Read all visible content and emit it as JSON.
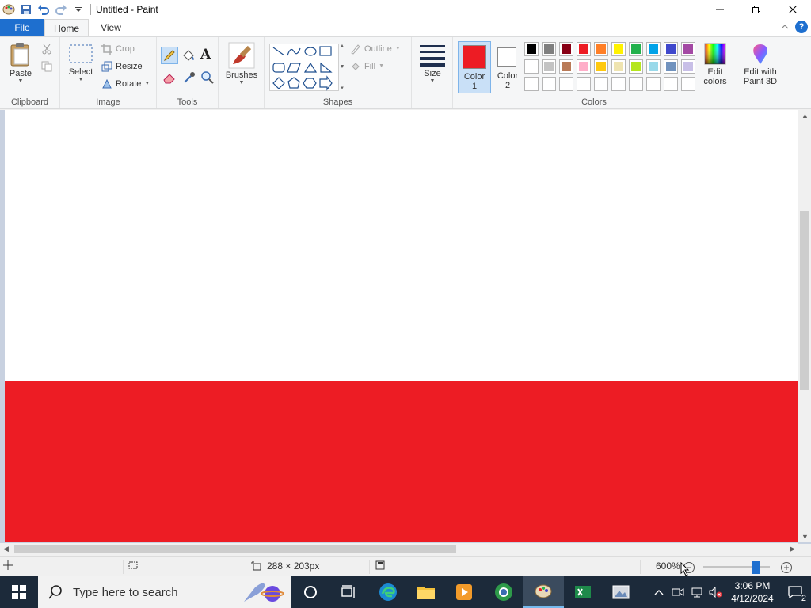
{
  "window": {
    "title": "Untitled - Paint"
  },
  "tabs": [
    {
      "label": "File"
    },
    {
      "label": "Home"
    },
    {
      "label": "View"
    }
  ],
  "ribbon": {
    "clipboard": {
      "group_label": "Clipboard",
      "paste": "Paste"
    },
    "image": {
      "group_label": "Image",
      "select": "Select",
      "crop": "Crop",
      "resize": "Resize",
      "rotate": "Rotate"
    },
    "tools": {
      "group_label": "Tools"
    },
    "brushes": {
      "label": "Brushes"
    },
    "shapes": {
      "group_label": "Shapes",
      "outline": "Outline",
      "fill": "Fill"
    },
    "size": {
      "label": "Size"
    },
    "color1": {
      "label": "Color\n1",
      "value": "#ed1c24"
    },
    "color2": {
      "label": "Color\n2",
      "value": "#ffffff"
    },
    "colors": {
      "group_label": "Colors",
      "row1": [
        "#000000",
        "#7f7f7f",
        "#880015",
        "#ed1c24",
        "#ff7f27",
        "#fff200",
        "#22b14c",
        "#00a2e8",
        "#3f48cc",
        "#a349a4"
      ],
      "row2": [
        "#ffffff",
        "#c3c3c3",
        "#b97a57",
        "#ffaec9",
        "#ffc90e",
        "#efe4b0",
        "#b5e61d",
        "#99d9ea",
        "#7092be",
        "#c8bfe7"
      ],
      "row3_count": 10
    },
    "edit_colors": "Edit\ncolors",
    "edit_paint3d": "Edit with\nPaint 3D"
  },
  "canvas": {
    "top_color": "#ffffff",
    "bottom_color": "#ed1c24"
  },
  "status": {
    "image_size": "288 × 203px",
    "zoom": "600%",
    "zoom_level_fraction": 0.82
  },
  "taskbar": {
    "search_placeholder": "Type here to search",
    "time": "3:06 PM",
    "date": "4/12/2024",
    "notification_count": "2"
  }
}
